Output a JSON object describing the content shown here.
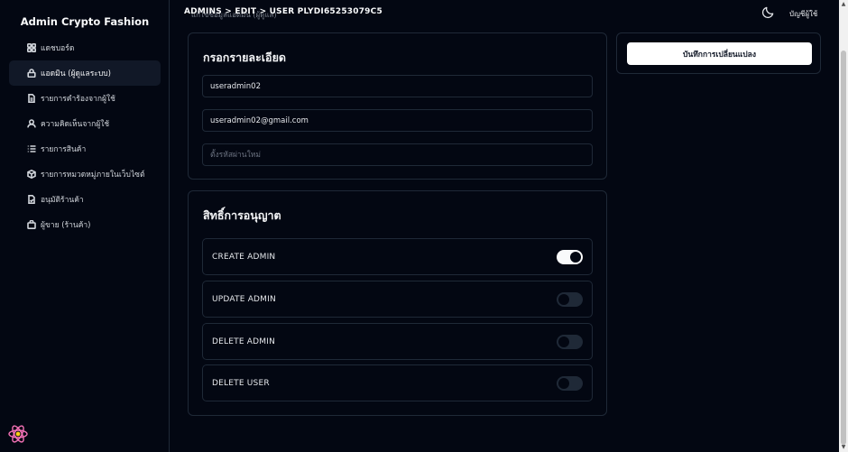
{
  "app": {
    "brand": "Admin Crypto Fashion"
  },
  "sidebar": {
    "items": [
      {
        "label": "แดชบอร์ด",
        "icon": "dashboard-icon"
      },
      {
        "label": "แอดมิน (ผู้ดูแลระบบ)",
        "icon": "lock-icon",
        "active": true
      },
      {
        "label": "รายการคำร้องจากผู้ใช้",
        "icon": "document-icon"
      },
      {
        "label": "ความคิดเห็นจากผู้ใช้",
        "icon": "user-icon"
      },
      {
        "label": "รายการสินค้า",
        "icon": "list-icon"
      },
      {
        "label": "รายการหมวดหมู่ภายในเว็บไซต์",
        "icon": "box-icon"
      },
      {
        "label": "อนุมัติร้านค้า",
        "icon": "file-check-icon"
      },
      {
        "label": "ผู้ขาย (ร้านค้า)",
        "icon": "bag-icon"
      }
    ]
  },
  "header": {
    "breadcrumb": "ADMINS > EDIT > USER PLYDI65253079C5",
    "subtitle": "แก้ไขข้อมูลแอดมิน (ผู้ดูแล)",
    "account_label": "บัญชีผู้ใช้"
  },
  "details": {
    "title": "กรอกรายละเอียด",
    "username": "useradmin02",
    "email": "useradmin02@gmail.com",
    "password_placeholder": "ตั้งรหัสผ่านใหม่"
  },
  "permissions": {
    "title": "สิทธิ์การอนุญาต",
    "items": [
      {
        "label": "CREATE ADMIN",
        "enabled": true
      },
      {
        "label": "UPDATE ADMIN",
        "enabled": false
      },
      {
        "label": "DELETE ADMIN",
        "enabled": false
      },
      {
        "label": "DELETE USER",
        "enabled": false
      }
    ]
  },
  "actions": {
    "save_label": "บันทึกการเปลี่ยนแปลง"
  },
  "colors": {
    "background": "#030712",
    "border": "#1f2937",
    "toggle_on": "#f9fafb",
    "toggle_off": "#1f2937"
  }
}
